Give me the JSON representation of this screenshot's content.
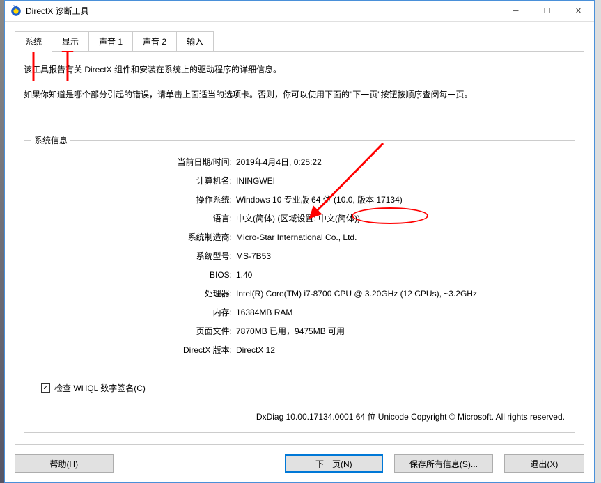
{
  "window": {
    "title": "DirectX 诊断工具"
  },
  "tabs": {
    "system": "系统",
    "display": "显示",
    "sound1": "声音 1",
    "sound2": "声音 2",
    "input": "输入"
  },
  "description": {
    "line1": "该工具报告有关 DirectX 组件和安装在系统上的驱动程序的详细信息。",
    "line2": "如果你知道是哪个部分引起的错误，请单击上面适当的选项卡。否则，你可以使用下面的\"下一页\"按钮按顺序查阅每一页。"
  },
  "groupbox": {
    "title": "系统信息"
  },
  "info": {
    "datetime_label": "当前日期/时间:",
    "datetime_value": "2019年4月4日, 0:25:22",
    "computer_label": "计算机名:",
    "computer_value": "ININGWEI",
    "os_label": "操作系统:",
    "os_value": "Windows 10 专业版 64 位 (10.0, 版本 17134)",
    "lang_label": "语言:",
    "lang_value": "中文(简体) (区域设置: 中文(简体))",
    "mfr_label": "系统制造商:",
    "mfr_value": "Micro-Star International Co., Ltd.",
    "model_label": "系统型号:",
    "model_value": "MS-7B53",
    "bios_label": "BIOS:",
    "bios_value": "1.40",
    "cpu_label": "处理器:",
    "cpu_value": "Intel(R) Core(TM) i7-8700 CPU @ 3.20GHz (12 CPUs), ~3.2GHz",
    "mem_label": "内存:",
    "mem_value": "16384MB RAM",
    "page_label": "页面文件:",
    "page_value": "7870MB 已用，9475MB 可用",
    "dx_label": "DirectX 版本:",
    "dx_value": "DirectX 12"
  },
  "checkbox": {
    "label": "检查 WHQL 数字签名(C)"
  },
  "copyright": "DxDiag 10.00.17134.0001 64 位 Unicode  Copyright © Microsoft. All rights reserved.",
  "buttons": {
    "help": "帮助(H)",
    "next": "下一页(N)",
    "save": "保存所有信息(S)...",
    "exit": "退出(X)"
  }
}
